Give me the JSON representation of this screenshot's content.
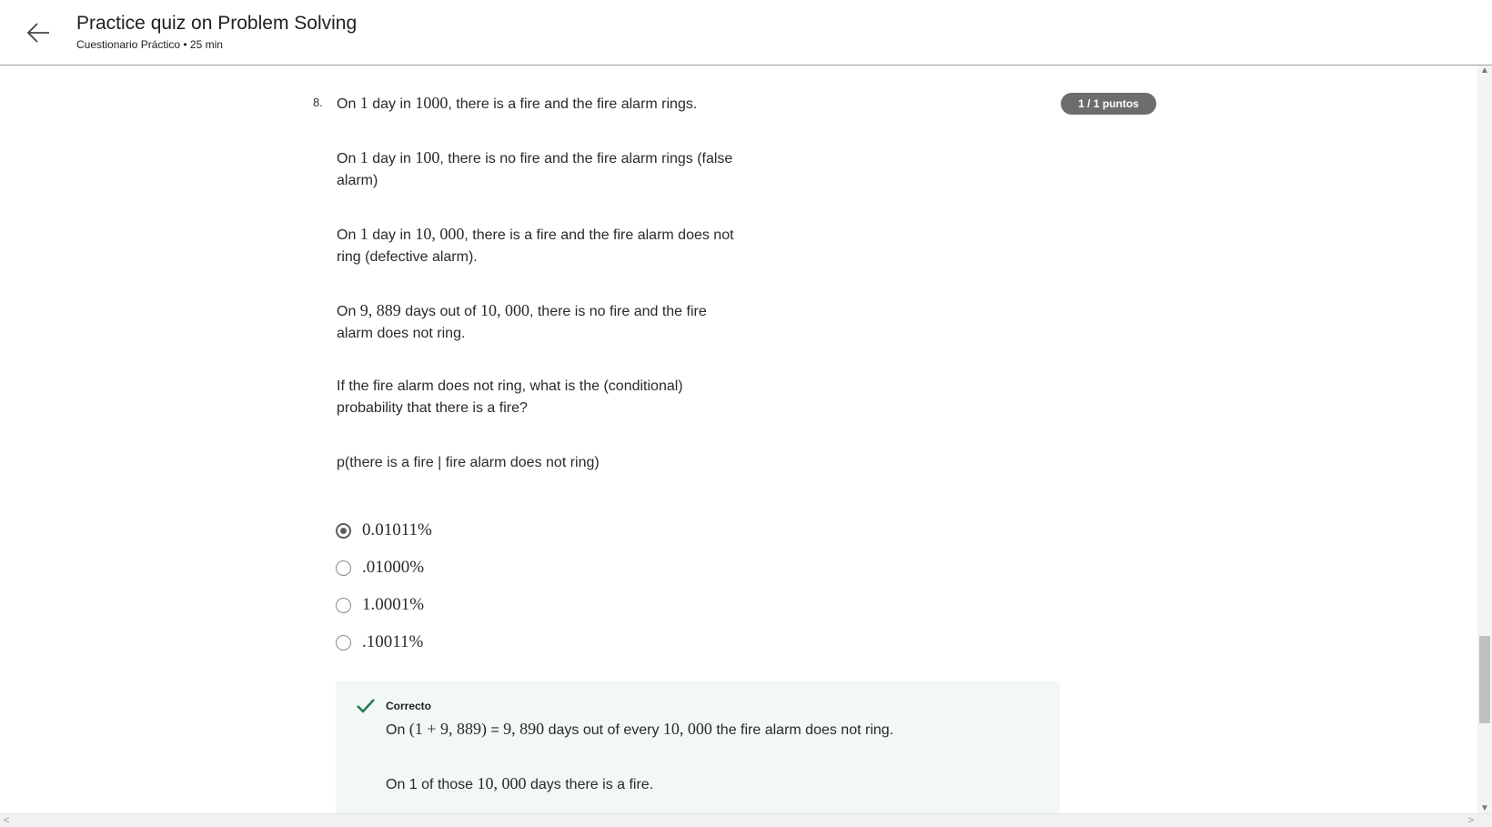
{
  "header": {
    "title": "Practice quiz on Problem Solving",
    "subtitle": "Cuestionario Práctico • 25 min",
    "back_icon": "arrow-left-icon"
  },
  "question": {
    "number": "8.",
    "points": "1 / 1 puntos",
    "paragraphs": [
      {
        "parts": [
          "On ",
          "1",
          " day in ",
          "1000",
          ", there is a fire and the fire alarm rings."
        ]
      },
      {
        "parts": [
          "On ",
          "1",
          " day in ",
          "100",
          ", there is no fire and the fire alarm rings (false alarm)"
        ]
      },
      {
        "parts": [
          "On ",
          "1",
          " day in ",
          "10, 000",
          ", there is a fire and the fire alarm does not ring (defective alarm)."
        ]
      },
      {
        "parts": [
          "On ",
          "9, 889",
          " days out of ",
          "10, 000",
          ", there is no fire and the fire alarm does not ring."
        ]
      },
      {
        "text": "If the fire alarm does not ring, what is the (conditional) probability that there is a fire?"
      },
      {
        "text": "p(there is a fire | fire alarm does not ring)"
      }
    ],
    "options": [
      {
        "label": "0.01011%",
        "selected": true
      },
      {
        "label": ".01000%",
        "selected": false
      },
      {
        "label": "1.0001%",
        "selected": false
      },
      {
        "label": ".10011%",
        "selected": false
      }
    ]
  },
  "feedback": {
    "status": "Correcto",
    "status_color": "#1f7a4f",
    "background": "#f2f8f5",
    "line1": {
      "parts": [
        "On ",
        "(1 + 9, 889)",
        " = ",
        "9, 890",
        " days out of every ",
        "10, 000",
        " the fire alarm does not ring."
      ]
    },
    "line2": {
      "parts": [
        "On ",
        "1",
        " of those ",
        "10, 000",
        " days there is a fire."
      ]
    }
  },
  "colors": {
    "badge": "#6d6d6d",
    "check": "#1f7a4f"
  }
}
